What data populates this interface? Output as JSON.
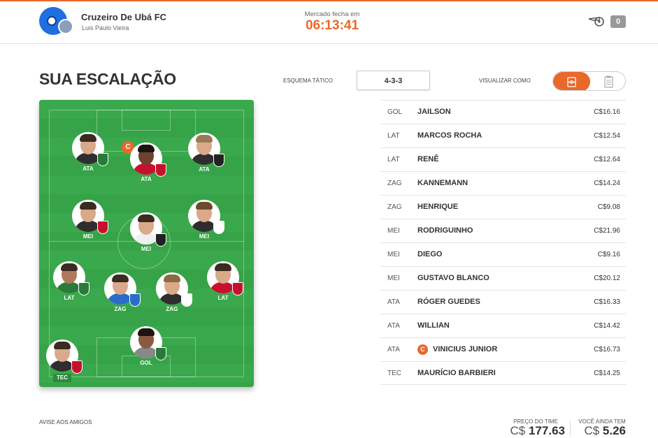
{
  "header": {
    "team_name": "Cruzeiro De Ubá FC",
    "owner_name": "Luis Paulo Vieira",
    "market_label": "Mercado fecha em",
    "market_time": "06:13:41",
    "notifications": "0"
  },
  "lineup": {
    "title": "SUA ESCALAÇÃO",
    "scheme_label": "ESQUEMA TÁTICO",
    "scheme_value": "4-3-3",
    "view_label": "VISUALIZAR COMO"
  },
  "field": {
    "captain_mark": "C",
    "players": [
      {
        "pos": "ATA",
        "shield": "#2a7b3a"
      },
      {
        "pos": "ATA",
        "shield": "#c8102e"
      },
      {
        "pos": "ATA",
        "shield": "#222222"
      },
      {
        "pos": "MEI",
        "shield": "#c8102e"
      },
      {
        "pos": "MEI",
        "shield": "#222222"
      },
      {
        "pos": "MEI",
        "shield": "#ffffff"
      },
      {
        "pos": "LAT",
        "shield": "#2a7b3a"
      },
      {
        "pos": "ZAG",
        "shield": "#2a6dc8"
      },
      {
        "pos": "ZAG",
        "shield": "#ffffff"
      },
      {
        "pos": "LAT",
        "shield": "#c8102e"
      },
      {
        "pos": "GOL",
        "shield": "#2a7b3a"
      },
      {
        "pos": "TEC",
        "shield": "#c8102e"
      }
    ]
  },
  "roster": [
    {
      "pos": "GOL",
      "name": "JAILSON",
      "price": "C$16.16"
    },
    {
      "pos": "LAT",
      "name": "MARCOS ROCHA",
      "price": "C$12.54"
    },
    {
      "pos": "LAT",
      "name": "RENÊ",
      "price": "C$12.64"
    },
    {
      "pos": "ZAG",
      "name": "KANNEMANN",
      "price": "C$14.24"
    },
    {
      "pos": "ZAG",
      "name": "HENRIQUE",
      "price": "C$9.08"
    },
    {
      "pos": "MEI",
      "name": "RODRIGUINHO",
      "price": "C$21.96"
    },
    {
      "pos": "MEI",
      "name": "DIEGO",
      "price": "C$9.16"
    },
    {
      "pos": "MEI",
      "name": "GUSTAVO BLANCO",
      "price": "C$20.12"
    },
    {
      "pos": "ATA",
      "name": "RÓGER GUEDES",
      "price": "C$16.33"
    },
    {
      "pos": "ATA",
      "name": "WILLIAN",
      "price": "C$14.42"
    },
    {
      "pos": "ATA",
      "name": "VINICIUS JUNIOR",
      "price": "C$16.73",
      "captain": "C"
    },
    {
      "pos": "TEC",
      "name": "MAURÍCIO BARBIERI",
      "price": "C$14.25"
    }
  ],
  "footer": {
    "share_label": "AVISE AOS AMIGOS",
    "price_label": "PREÇO DO TIME",
    "price_currency": "C$",
    "price_value": "177.63",
    "left_label": "VOCÊ AINDA TEM",
    "left_currency": "C$",
    "left_value": "5.26"
  },
  "colors": {
    "accent": "#e8692b",
    "pitch": "#37a348"
  }
}
